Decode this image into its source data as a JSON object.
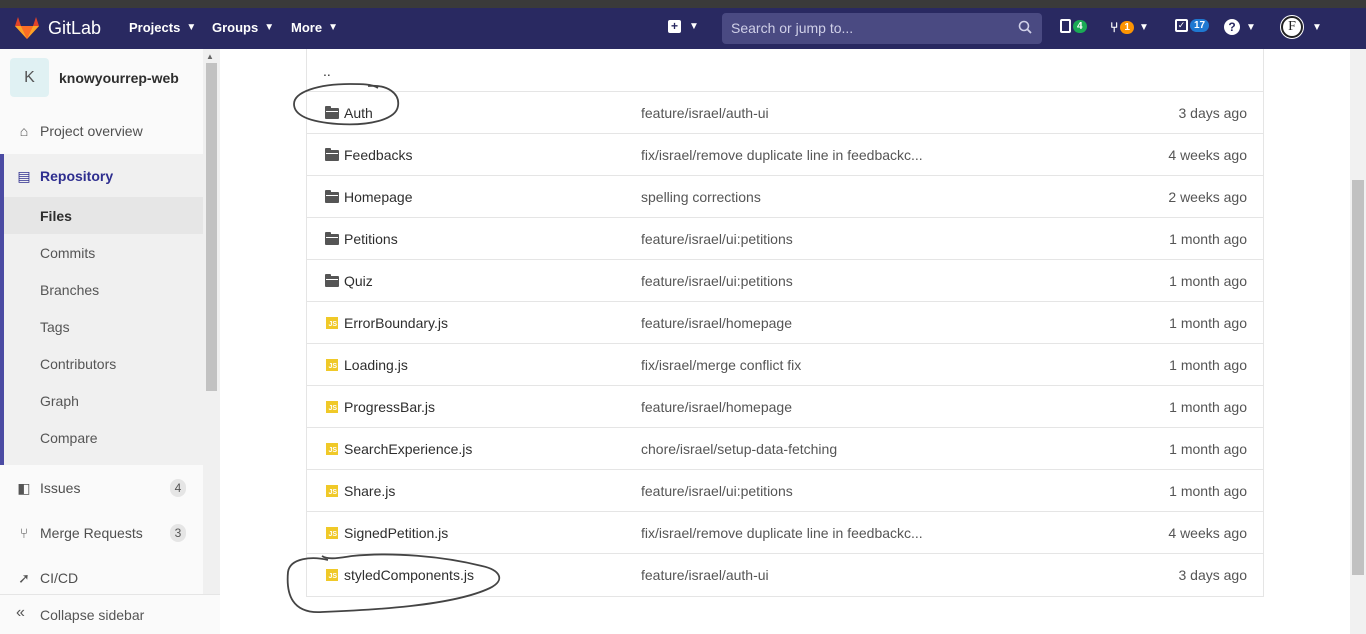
{
  "navbar": {
    "brand": "GitLab",
    "projects": "Projects",
    "groups": "Groups",
    "more": "More",
    "search_placeholder": "Search or jump to...",
    "issues_count": "4",
    "mr_count": "1",
    "todos_count": "17",
    "user_initial": "F",
    "colors": {
      "bg": "#292961",
      "issues_badge": "#1aaa55",
      "mr_badge": "#fc9403",
      "todo_badge": "#1f78d1"
    }
  },
  "sidebar": {
    "project_initial": "K",
    "project_name": "knowyourrep-web",
    "project_overview": "Project overview",
    "repository": "Repository",
    "sub_items": [
      "Files",
      "Commits",
      "Branches",
      "Tags",
      "Contributors",
      "Graph",
      "Compare"
    ],
    "issues": "Issues",
    "issues_count": "4",
    "merge_requests": "Merge Requests",
    "merge_requests_count": "3",
    "cicd": "CI/CD",
    "collapse": "Collapse sidebar"
  },
  "tree": {
    "parent": "..",
    "rows": [
      {
        "type": "folder",
        "name": "Auth",
        "commit": "feature/israel/auth-ui",
        "time": "3 days ago"
      },
      {
        "type": "folder",
        "name": "Feedbacks",
        "commit": "fix/israel/remove duplicate line in feedbackc...",
        "time": "4 weeks ago"
      },
      {
        "type": "folder",
        "name": "Homepage",
        "commit": "spelling corrections",
        "time": "2 weeks ago"
      },
      {
        "type": "folder",
        "name": "Petitions",
        "commit": "feature/israel/ui:petitions",
        "time": "1 month ago"
      },
      {
        "type": "folder",
        "name": "Quiz",
        "commit": "feature/israel/ui:petitions",
        "time": "1 month ago"
      },
      {
        "type": "js",
        "name": "ErrorBoundary.js",
        "commit": "feature/israel/homepage",
        "time": "1 month ago"
      },
      {
        "type": "js",
        "name": "Loading.js",
        "commit": "fix/israel/merge conflict fix",
        "time": "1 month ago"
      },
      {
        "type": "js",
        "name": "ProgressBar.js",
        "commit": "feature/israel/homepage",
        "time": "1 month ago"
      },
      {
        "type": "js",
        "name": "SearchExperience.js",
        "commit": "chore/israel/setup-data-fetching",
        "time": "1 month ago"
      },
      {
        "type": "js",
        "name": "Share.js",
        "commit": "feature/israel/ui:petitions",
        "time": "1 month ago"
      },
      {
        "type": "js",
        "name": "SignedPetition.js",
        "commit": "fix/israel/remove duplicate line in feedbackc...",
        "time": "4 weeks ago"
      },
      {
        "type": "js",
        "name": "styledComponents.js",
        "commit": "feature/israel/auth-ui",
        "time": "3 days ago"
      }
    ]
  }
}
